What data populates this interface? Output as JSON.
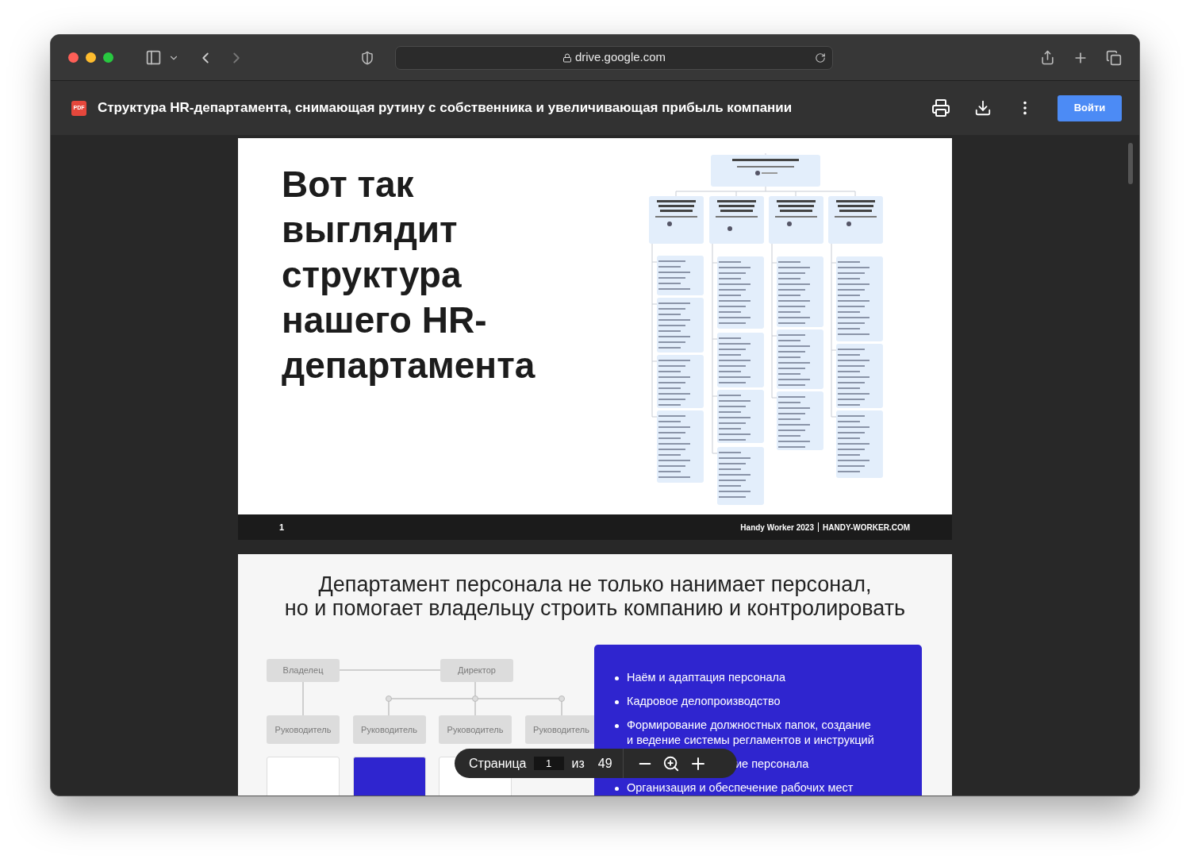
{
  "browser": {
    "url": "drive.google.com"
  },
  "viewer": {
    "title": "Структура HR-департамента, снимающая рутину с собственника и увеличивающая прибыль компании",
    "file_badge": "PDF",
    "sign_in": "Войти"
  },
  "page1": {
    "heading": "Вот так выглядит структура нашего HR-департамента",
    "page_number": "1",
    "brand": "Handy Worker 2023",
    "site": "HANDY-WORKER.COM"
  },
  "page2": {
    "heading_lines": [
      "Департамент персонала не только нанимает персонал,",
      "но и помогает владельцу строить компанию и контролировать"
    ],
    "top_nodes": [
      {
        "label": "Владелец"
      },
      {
        "label": "Директор"
      }
    ],
    "manager_nodes": [
      {
        "label": "Руководитель"
      },
      {
        "label": "Руководитель"
      },
      {
        "label": "Руководитель"
      },
      {
        "label": "Руководитель"
      }
    ],
    "cards": [
      {
        "color": "#ffffff"
      },
      {
        "color": "#2f25cf"
      },
      {
        "color": "#ffffff"
      }
    ],
    "list": [
      {
        "kind": "full",
        "text": "Наём и адаптация персонала"
      },
      {
        "kind": "full",
        "text": "Кадровое делопроизводство"
      },
      {
        "kind": "full",
        "text": "Формирование должностных папок, создание и ведение системы регламентов и инструкций"
      },
      {
        "kind": "partial",
        "text": "ие персонала"
      },
      {
        "kind": "full",
        "text": "Организация и обеспечение рабочих мест"
      }
    ]
  },
  "page_control": {
    "label": "Страница",
    "current": "1",
    "of": "из",
    "total": "49"
  }
}
